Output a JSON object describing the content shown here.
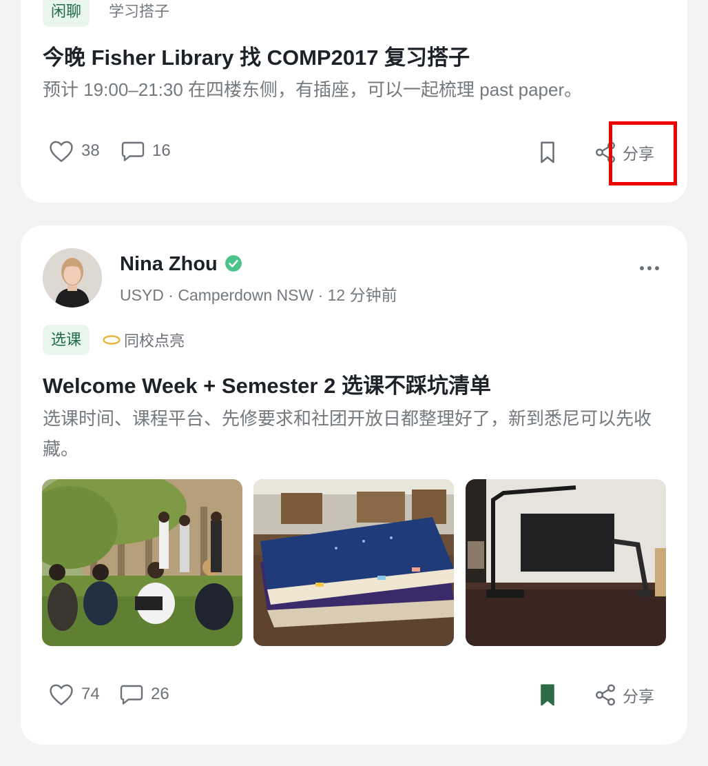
{
  "posts": [
    {
      "tag": "闲聊",
      "subtag": "学习搭子",
      "title": "今晚 Fisher Library 找 COMP2017 复习搭子",
      "body": "预计 19:00–21:30 在四楼东侧，有插座，可以一起梳理 past paper。",
      "likes": "38",
      "comments": "16",
      "share_label": "分享",
      "bookmarked": false
    },
    {
      "author": {
        "name": "Nina Zhou",
        "verified": true,
        "meta": "USYD · Camperdown NSW · 12 分钟前"
      },
      "tag": "选课",
      "badge": "同校点亮",
      "title": "Welcome Week + Semester 2 选课不踩坑清单",
      "body": "选课时间、课程平台、先修要求和社团开放日都整理好了，新到悉尼可以先收藏。",
      "images": [
        "campus-lawn-students-photo",
        "stacked-notebooks-photo",
        "desk-lamp-monitor-photo"
      ],
      "likes": "74",
      "comments": "26",
      "share_label": "分享",
      "bookmarked": true
    }
  ],
  "colors": {
    "accent_green": "#2f6b45",
    "tag_bg": "#e8f6ee",
    "verified_green": "#4cc38a",
    "highlight_red": "#ee0000"
  }
}
